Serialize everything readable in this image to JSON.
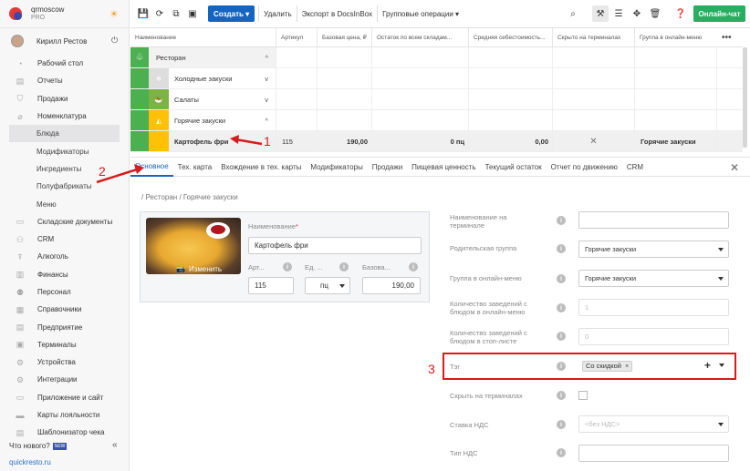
{
  "brand": {
    "name": "qrmoscow",
    "plan": "PRO"
  },
  "user": {
    "name": "Кирилл Рестов"
  },
  "sidebar": {
    "items": [
      {
        "label": "Рабочий стол",
        "icon": "dashboard-icon",
        "sub": false
      },
      {
        "label": "Отчеты",
        "icon": "reports-icon",
        "sub": false
      },
      {
        "label": "Продажи",
        "icon": "sales-icon",
        "sub": false
      },
      {
        "label": "Номенклатура",
        "icon": "nomenclature-icon",
        "sub": false
      },
      {
        "label": "Блюда",
        "icon": "",
        "sub": true,
        "active": true
      },
      {
        "label": "Модификаторы",
        "icon": "",
        "sub": true
      },
      {
        "label": "Ингредиенты",
        "icon": "",
        "sub": true
      },
      {
        "label": "Полуфабрикаты",
        "icon": "",
        "sub": true
      },
      {
        "label": "Меню",
        "icon": "",
        "sub": true
      },
      {
        "label": "Складские документы",
        "icon": "warehouse-icon",
        "sub": false
      },
      {
        "label": "CRM",
        "icon": "crm-icon",
        "sub": false
      },
      {
        "label": "Алкоголь",
        "icon": "alcohol-icon",
        "sub": false
      },
      {
        "label": "Финансы",
        "icon": "finance-icon",
        "sub": false
      },
      {
        "label": "Персонал",
        "icon": "staff-icon",
        "sub": false
      },
      {
        "label": "Справочники",
        "icon": "directory-icon",
        "sub": false
      },
      {
        "label": "Предприятие",
        "icon": "enterprise-icon",
        "sub": false
      },
      {
        "label": "Терминалы",
        "icon": "terminal-icon",
        "sub": false
      },
      {
        "label": "Устройства",
        "icon": "devices-icon",
        "sub": false
      },
      {
        "label": "Интеграции",
        "icon": "integrations-icon",
        "sub": false
      },
      {
        "label": "Приложение и сайт",
        "icon": "app-icon",
        "sub": false
      },
      {
        "label": "Карты лояльности",
        "icon": "loyalty-icon",
        "sub": false
      },
      {
        "label": "Шаблонизатор чека",
        "icon": "receipt-icon",
        "sub": false
      }
    ],
    "whats_new": "Что нового?",
    "new_badge": "NEW",
    "footer_link": "quickresto.ru"
  },
  "toolbar": {
    "create": "Создать",
    "delete": "Удалить",
    "export": "Экспорт в DocsInBox",
    "group_ops": "Групповые операции",
    "chat": "Онлайн-чат"
  },
  "table": {
    "columns": [
      "Наименование",
      "Артикул",
      "Базовая цена, ₽",
      "Остаток по всем складам...",
      "Средняя себестоимость...",
      "Скрыто на терминалах",
      "Группа в онлайн-меню"
    ],
    "rows": [
      {
        "name": "Ресторан",
        "level": 0,
        "type": "group",
        "chevron": "^"
      },
      {
        "name": "Холодные закуски",
        "level": 1,
        "type": "group",
        "chevron": "v"
      },
      {
        "name": "Салаты",
        "level": 1,
        "type": "group",
        "chevron": "v"
      },
      {
        "name": "Горячие закуски",
        "level": 1,
        "type": "group",
        "chevron": "^"
      },
      {
        "name": "Картофель фри",
        "level": 2,
        "type": "item",
        "article": "115",
        "price": "190,00",
        "stock": "0 пц",
        "cost": "0,00",
        "hidden": "✕",
        "online_group": "Горячие закуски"
      }
    ]
  },
  "tabs": [
    "Основное",
    "Тех. карта",
    "Вхождение в тех. карты",
    "Модификаторы",
    "Продажи",
    "Пищевая ценность",
    "Текущий остаток",
    "Отчет по движению",
    "CRM"
  ],
  "form": {
    "breadcrumb": "/ Ресторан / Горячие закуски",
    "photo_change": "Изменить",
    "name_label": "Наименование",
    "name_value": "Картофель фри",
    "article_label": "Арт...",
    "article_value": "115",
    "unit_label": "Ед. ...",
    "unit_value": "пц",
    "price_label": "Базова...",
    "price_value": "190,00"
  },
  "right_form": {
    "fields": [
      {
        "label": "Наименование на терминале",
        "value": "",
        "kind": "input"
      },
      {
        "label": "Родительская группа",
        "value": "Горячие закуски",
        "kind": "select"
      },
      {
        "label": "Группа в онлайн-меню",
        "value": "Горячие закуски",
        "kind": "select"
      },
      {
        "label": "Количество заведений с блюдом в онлайн-меню",
        "value": "1",
        "kind": "disabled"
      },
      {
        "label": "Количество заведений с блюдом в стоп-листе",
        "value": "0",
        "kind": "disabled"
      },
      {
        "label": "Тэг",
        "value": "Со скидкой",
        "kind": "tags"
      },
      {
        "label": "Скрыть на терминалах",
        "value": "",
        "kind": "checkbox"
      },
      {
        "label": "Ставка НДС",
        "value": "<без НДС>",
        "kind": "select-disabled"
      },
      {
        "label": "Тип НДС",
        "value": "",
        "kind": "input"
      }
    ]
  },
  "annotations": {
    "n1": "1",
    "n2": "2",
    "n3": "3"
  },
  "colors": {
    "accent": "#1565c0",
    "chat": "#27ae60",
    "annotation": "#d61c1c",
    "cat_green": "#4caf50",
    "cat_yellow": "#ffc107"
  }
}
